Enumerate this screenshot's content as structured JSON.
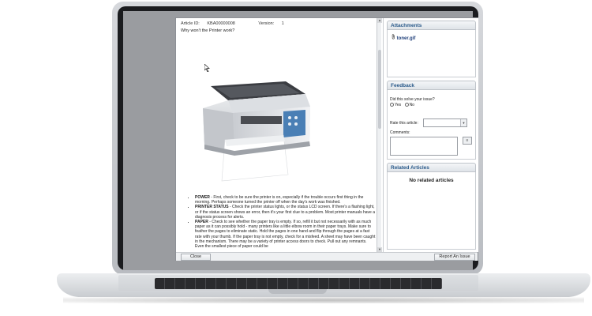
{
  "article": {
    "id_label": "Article ID:",
    "id_value": "KBA00000008",
    "version_label": "Version:",
    "version_value": "1",
    "question": "Why won't the Printer work?"
  },
  "content": {
    "steps": [
      {
        "title": "POWER",
        "text": " - First, check to be sure the printer is on, especially if the trouble occurs first thing in the morning. Perhaps someone turned the printer off when the day's work was finished."
      },
      {
        "title": "PRINTER STATUS",
        "text": " - Check the printer status lights, or the status LCD screen. If there's a flashing light, or if the status screen shows an error, then it's your first clue to a problem. Most printer manuals have a diagnosis process for alerts."
      },
      {
        "title": "PAPER",
        "text": " - Check to see whether the paper tray is empty. If so, refill it but not necessarily with as much paper as it can possibly hold - many printers like a little elbow room in their paper trays. Make sure to feather the pages to eliminate static. Hold the pages in one hand and flip through the pages at a fast rate with your thumb. If the paper tray is not empty, check for a misfeed. A sheet may have been caught in the mechanism. There may be a variety of printer access doors to check. Pull out any remnants. Even the smallest piece of paper could be"
      }
    ]
  },
  "attachments": {
    "header": "Attachments",
    "file": "toner.gif"
  },
  "feedback": {
    "header": "Feedback",
    "question": "Did this solve your issue?",
    "yes": "Yes",
    "no": "No",
    "rate_label": "Rate this article:",
    "comments_label": "Comments:"
  },
  "related": {
    "header": "Related Articles",
    "empty": "No related articles"
  },
  "footer": {
    "close": "Close",
    "report": "Report An Issue"
  },
  "icons": {
    "attachment": "paperclip-icon",
    "dropdown": "chevron-down-icon",
    "cursor": "mouse-pointer-icon"
  }
}
